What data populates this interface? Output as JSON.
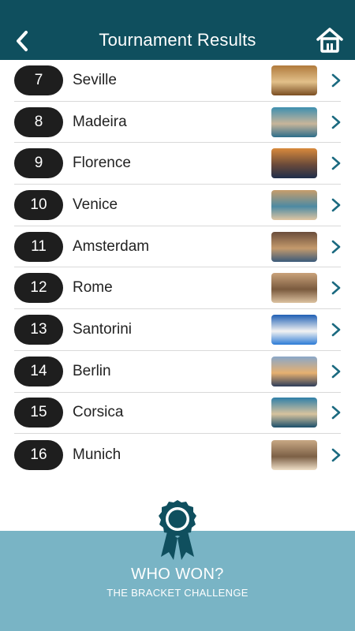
{
  "header": {
    "title": "Tournament Results",
    "back_icon": "chevron-left-icon",
    "home_icon": "home-icon",
    "bg_color": "#0f4f5e"
  },
  "results": [
    {
      "seed": "7",
      "city": "Seville",
      "thumb_colors": [
        "#b07a3c",
        "#e2c08a",
        "#7b4e22"
      ]
    },
    {
      "seed": "8",
      "city": "Madeira",
      "thumb_colors": [
        "#3e8fb0",
        "#c8b59a",
        "#2d6d8a"
      ]
    },
    {
      "seed": "9",
      "city": "Florence",
      "thumb_colors": [
        "#d98a3c",
        "#6a4a3a",
        "#1f2d4a"
      ]
    },
    {
      "seed": "10",
      "city": "Venice",
      "thumb_colors": [
        "#c79d6b",
        "#4d8aa3",
        "#e0c6a2"
      ]
    },
    {
      "seed": "11",
      "city": "Amsterdam",
      "thumb_colors": [
        "#6a4d3b",
        "#c49a6c",
        "#3b5a7a"
      ]
    },
    {
      "seed": "12",
      "city": "Rome",
      "thumb_colors": [
        "#c9a27a",
        "#7a5a3e",
        "#dcc2a0"
      ]
    },
    {
      "seed": "13",
      "city": "Santorini",
      "thumb_colors": [
        "#1f5fb5",
        "#f2f2f2",
        "#2c7bd6"
      ]
    },
    {
      "seed": "14",
      "city": "Berlin",
      "thumb_colors": [
        "#8aa7c8",
        "#e6b070",
        "#2e3d5a"
      ]
    },
    {
      "seed": "15",
      "city": "Corsica",
      "thumb_colors": [
        "#2f7fa8",
        "#d7c39e",
        "#1b4f6a"
      ]
    },
    {
      "seed": "16",
      "city": "Munich",
      "thumb_colors": [
        "#c8a884",
        "#7c6046",
        "#efe0c8"
      ]
    }
  ],
  "list_icons": {
    "chevron": "chevron-right-icon",
    "chevron_color": "#1b6a80"
  },
  "footer": {
    "title": "WHO WON?",
    "subtitle": "THE BRACKET CHALLENGE",
    "badge_icon": "award-ribbon-icon",
    "bg_color": "#79b4c5",
    "badge_color": "#0f4f5e"
  }
}
